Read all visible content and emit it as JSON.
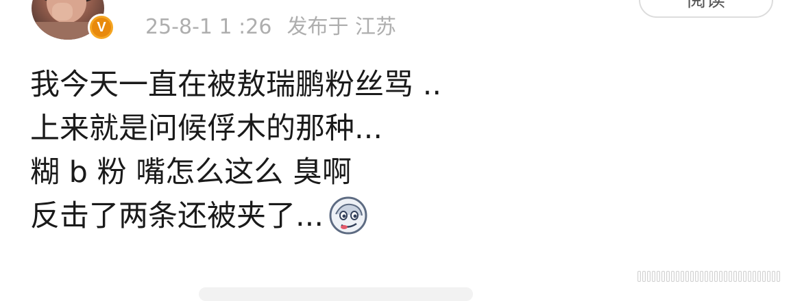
{
  "post": {
    "meta": {
      "timestamp": "25-8-1 1 :26",
      "published_label": "发布于",
      "location": "江苏"
    },
    "read_button_label": "阅读",
    "lines": [
      "我今天一直在被敖瑞鹏粉丝骂 ..",
      "上来就是问候俘木的那种...",
      "糊 b 粉 嘴怎么这么 臭啊",
      "反击了两条还被夹了..."
    ],
    "emoji_icon": "smirk-face-emoji-icon"
  },
  "author": {
    "verified_badge": "V",
    "badge_color": "#f5a623"
  }
}
